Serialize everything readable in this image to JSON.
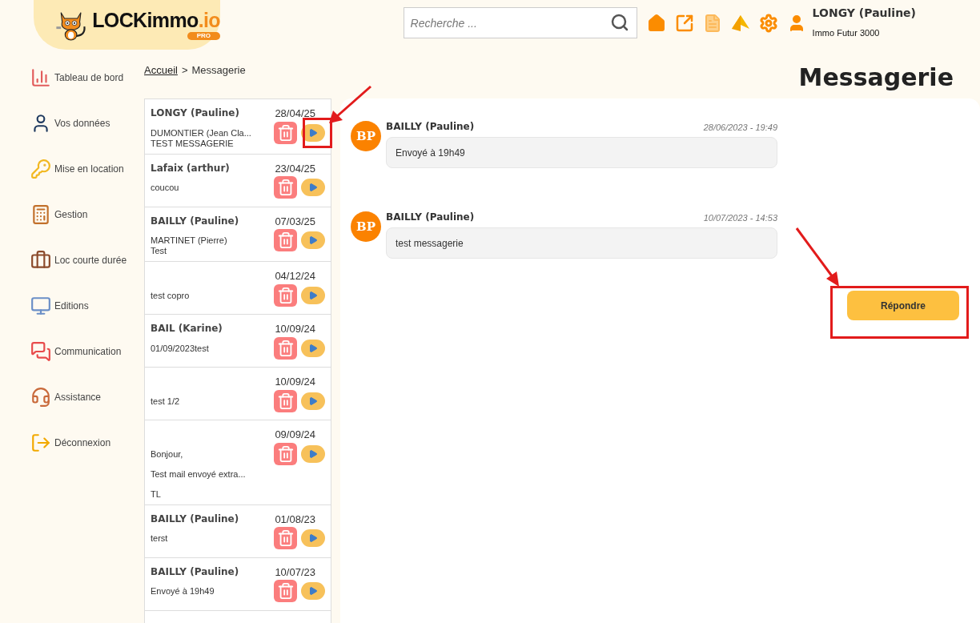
{
  "logo": {
    "name": "LOCKimmo",
    "suffix": ".io",
    "badge": "PRO"
  },
  "search": {
    "placeholder": "Recherche ..."
  },
  "user": {
    "name": "LONGY (Pauline)",
    "company": "Immo Futur 3000"
  },
  "sidebar": {
    "items": [
      {
        "label": "Tableau de bord"
      },
      {
        "label": "Vos données"
      },
      {
        "label": "Mise en location"
      },
      {
        "label": "Gestion"
      },
      {
        "label": "Loc courte durée"
      },
      {
        "label": "Editions"
      },
      {
        "label": "Communication"
      },
      {
        "label": "Assistance"
      },
      {
        "label": "Déconnexion"
      }
    ]
  },
  "breadcrumb": {
    "link": "Accueil",
    "separator": ">",
    "current": "Messagerie"
  },
  "page_title": "Messagerie",
  "conversations": [
    {
      "name": "LONGY (Pauline)",
      "date": "28/04/25",
      "lines": [
        "DUMONTIER (Jean Cla...\nTEST MESSAGERIE"
      ]
    },
    {
      "name": "Lafaix (arthur)",
      "date": "23/04/25",
      "lines": [
        "coucou"
      ]
    },
    {
      "name": "BAILLY (Pauline)",
      "date": "07/03/25",
      "lines": [
        "MARTINET (Pierre)\nTest"
      ]
    },
    {
      "date": "04/12/24",
      "lines": [
        "test copro"
      ]
    },
    {
      "name": "BAIL (Karine)",
      "date": "10/09/24",
      "lines": [
        "01/09/2023test"
      ]
    },
    {
      "date": "10/09/24",
      "lines": [
        "test 1/2"
      ]
    },
    {
      "date": "09/09/24",
      "lines": [
        "Bonjour,",
        "Test mail envoyé extra...",
        "TL"
      ]
    },
    {
      "name": "BAILLY (Pauline)",
      "date": "01/08/23",
      "lines": [
        "terst"
      ]
    },
    {
      "name": "BAILLY (Pauline)",
      "date": "10/07/23",
      "lines": [
        "Envoyé à 19h49"
      ]
    }
  ],
  "messages": [
    {
      "initials": "BP",
      "author": "BAILLY (Pauline)",
      "datetime": "28/06/2023 - 19:49",
      "text": "Envoyé à 19h49"
    },
    {
      "initials": "BP",
      "author": "BAILLY (Pauline)",
      "datetime": "10/07/2023 - 14:53",
      "text": "test messagerie"
    }
  ],
  "reply_button": "Répondre"
}
